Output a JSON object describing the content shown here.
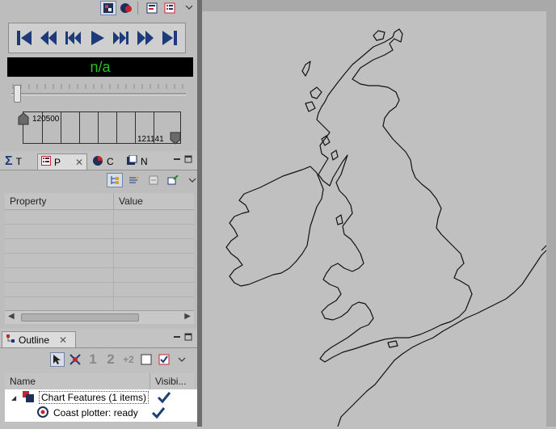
{
  "time_controller": {
    "time_display": "n/a",
    "range_start_label": "120500",
    "range_end_label": "121141",
    "toolbar_icons": [
      "display-mode-icon",
      "properties-icon",
      "report-icon",
      "list-icon"
    ]
  },
  "properties_view": {
    "tabs": [
      {
        "label": "T",
        "icon": "sigma-icon"
      },
      {
        "label": "P",
        "icon": "properties-icon"
      },
      {
        "label": "C",
        "icon": "chart-icon"
      },
      {
        "label": "N",
        "icon": "narrative-icon"
      }
    ],
    "columns": [
      "Property",
      "Value"
    ]
  },
  "outline_view": {
    "title": "Outline",
    "columns": [
      "Name",
      "Visibi..."
    ],
    "tool_labels": {
      "one": "1",
      "two": "2",
      "plus_two": "+2"
    },
    "items": [
      {
        "label": "Chart Features (1 items)",
        "visible": true
      },
      {
        "label": "Coast plotter: ready",
        "visible": true
      }
    ]
  },
  "colors": {
    "time_text": "#24c324",
    "checkmark": "#1c3f74",
    "panel_bg": "#bdbdbd",
    "map_bg": "#c0c0c0"
  }
}
